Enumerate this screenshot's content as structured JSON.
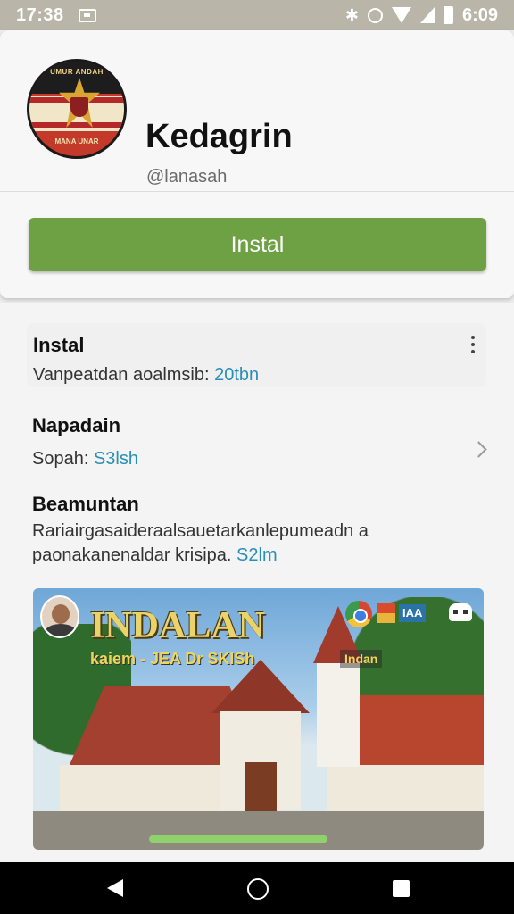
{
  "status_bar": {
    "time_left": "17:38",
    "time_right": "6:09",
    "icons": [
      "screen-record-icon",
      "bluetooth-icon",
      "alarm-icon",
      "wifi-icon",
      "signal-icon",
      "battery-icon"
    ]
  },
  "app": {
    "name": "Kedagrin",
    "handle": "@lanasah",
    "logo_top_text": "UMUR ANDAH",
    "logo_bottom_text": "MANA UNAR",
    "install_label": "Instal",
    "accent_color": "#6ea044"
  },
  "sections": {
    "install": {
      "title": "Instal",
      "text": "Vanpeatdan aoalmsib: ",
      "value": "20tbn"
    },
    "download": {
      "title": "Napadain",
      "text": "Sopah: ",
      "value": "S3lsh"
    },
    "description": {
      "title": "Beamuntan",
      "line1": "Rariairgasaideraalsauetarkanlepumeadn a",
      "line2": "paonakanenaldar krisipa. ",
      "value": "S2lm"
    }
  },
  "banner": {
    "headline": "INDALAN",
    "subtitle": "kaiem - JEA Dr SKISh",
    "chip": "Indan",
    "badge": "IAA"
  },
  "nav_bar": {
    "buttons": [
      "back-icon",
      "home-icon",
      "recent-apps-icon"
    ]
  }
}
